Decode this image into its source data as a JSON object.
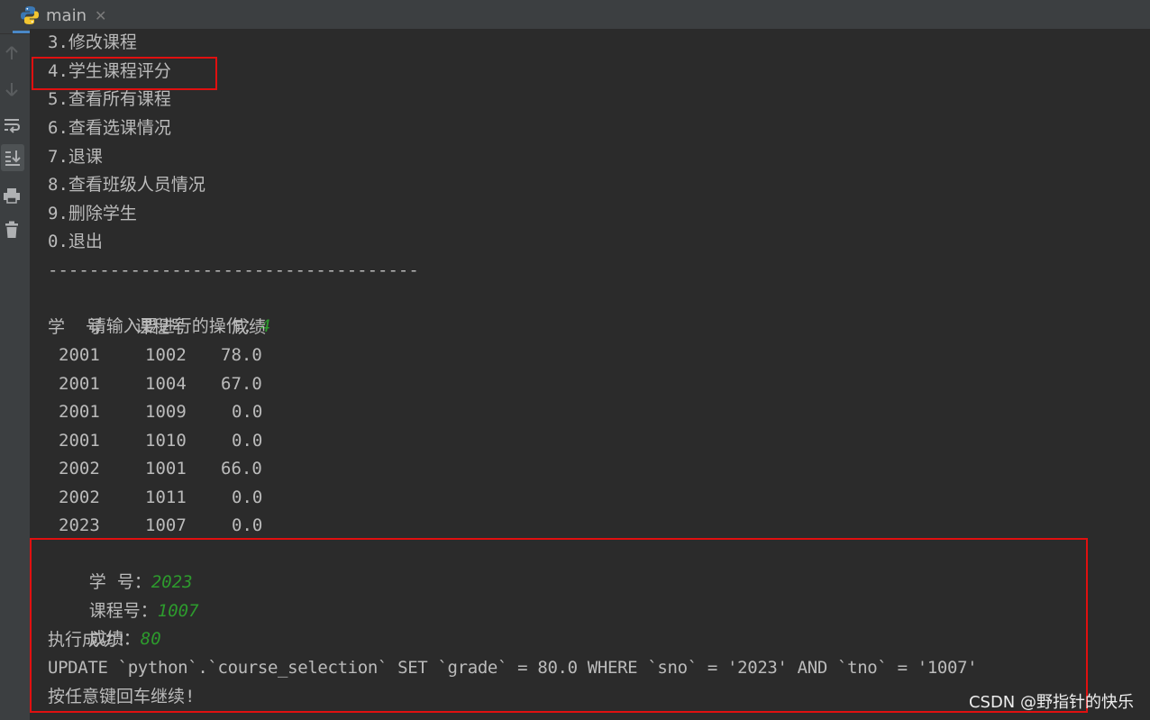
{
  "tab": {
    "title": "main",
    "close_icon": "close-icon"
  },
  "toolbar": {
    "buttons": [
      {
        "name": "up-arrow-icon",
        "active": false
      },
      {
        "name": "down-arrow-icon",
        "active": false
      },
      {
        "name": "soft-wrap-icon",
        "active": false
      },
      {
        "name": "scroll-to-end-icon",
        "active": true
      },
      {
        "name": "print-icon",
        "active": false
      },
      {
        "name": "trash-icon",
        "active": false
      }
    ]
  },
  "menu": [
    "3.修改课程",
    "4.学生课程评分",
    "5.查看所有课程",
    "6.查看选课情况",
    "7.退课",
    "8.查看班级人员情况",
    "9.删除学生",
    "0.退出"
  ],
  "separator": "------------------------------------",
  "prompt": {
    "label": "请输入要进行的操作：",
    "value": "4"
  },
  "table": {
    "headers": [
      "学  号",
      "课程号",
      "成绩"
    ],
    "rows": [
      [
        "2001",
        "1002",
        "78.0"
      ],
      [
        "2001",
        "1004",
        "67.0"
      ],
      [
        "2001",
        "1009",
        "0.0"
      ],
      [
        "2001",
        "1010",
        "0.0"
      ],
      [
        "2002",
        "1001",
        "66.0"
      ],
      [
        "2002",
        "1011",
        "0.0"
      ],
      [
        "2023",
        "1007",
        "0.0"
      ]
    ]
  },
  "form": {
    "sno_label": "学  号：",
    "sno_value": "2023",
    "tno_label": "课程号：",
    "tno_value": "1007",
    "grade_label": "成绩：",
    "grade_value": "80"
  },
  "result": {
    "success": "执行成功!",
    "sql": "UPDATE `python`.`course_selection` SET `grade` = 80.0 WHERE `sno` = '2023' AND `tno` = '1007'",
    "continue": "按任意键回车继续!"
  },
  "watermark": "CSDN @野指针的快乐",
  "colors": {
    "background": "#2b2b2b",
    "text": "#bbbbbb",
    "input": "#2d9b2d",
    "highlight": "#e01010"
  }
}
